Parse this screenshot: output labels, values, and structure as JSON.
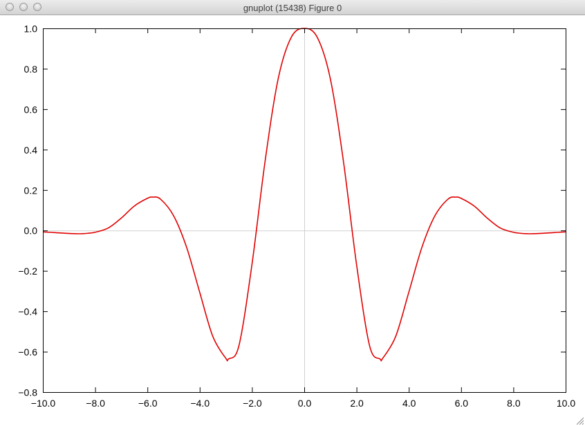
{
  "window": {
    "title": "gnuplot (15438) Figure 0"
  },
  "chart_data": {
    "type": "line",
    "title": "",
    "xlabel": "",
    "ylabel": "",
    "xlim": [
      -10,
      10
    ],
    "ylim": [
      -0.8,
      1.0
    ],
    "xticks": [
      "-10.0",
      "-8.0",
      "-6.0",
      "-4.0",
      "-2.0",
      "0.0",
      "2.0",
      "4.0",
      "6.0",
      "8.0",
      "10.0"
    ],
    "yticks": [
      "1.0",
      "0.8",
      "0.6",
      "0.4",
      "0.2",
      "0.0",
      "-0.2",
      "-0.4",
      "-0.6",
      "-0.8"
    ],
    "zero_axes": true,
    "grid": false,
    "series": [
      {
        "color": "#e00000",
        "x": [
          -10.0,
          -9.5,
          -9.0,
          -8.5,
          -8.0,
          -7.5,
          -7.0,
          -6.5,
          -6.0,
          -5.8,
          -5.5,
          -5.0,
          -4.5,
          -4.0,
          -3.5,
          -3.0,
          -2.9,
          -2.5,
          -2.0,
          -1.5,
          -1.0,
          -0.5,
          0.0,
          0.5,
          1.0,
          1.5,
          2.0,
          2.5,
          2.9,
          3.0,
          3.5,
          4.0,
          4.5,
          5.0,
          5.5,
          5.8,
          6.0,
          6.5,
          7.0,
          7.5,
          8.0,
          8.5,
          9.0,
          9.5,
          10.0
        ],
        "y": [
          -0.007,
          -0.011,
          -0.015,
          -0.016,
          -0.009,
          0.012,
          0.061,
          0.121,
          0.159,
          0.165,
          0.155,
          0.073,
          -0.084,
          -0.306,
          -0.524,
          -0.633,
          -0.636,
          -0.571,
          -0.168,
          0.341,
          0.749,
          0.955,
          1.0,
          0.955,
          0.749,
          0.341,
          -0.168,
          -0.571,
          -0.636,
          -0.633,
          -0.524,
          -0.306,
          -0.084,
          0.073,
          0.155,
          0.165,
          0.159,
          0.121,
          0.061,
          0.012,
          -0.009,
          -0.016,
          -0.015,
          -0.011,
          -0.007
        ]
      }
    ]
  }
}
